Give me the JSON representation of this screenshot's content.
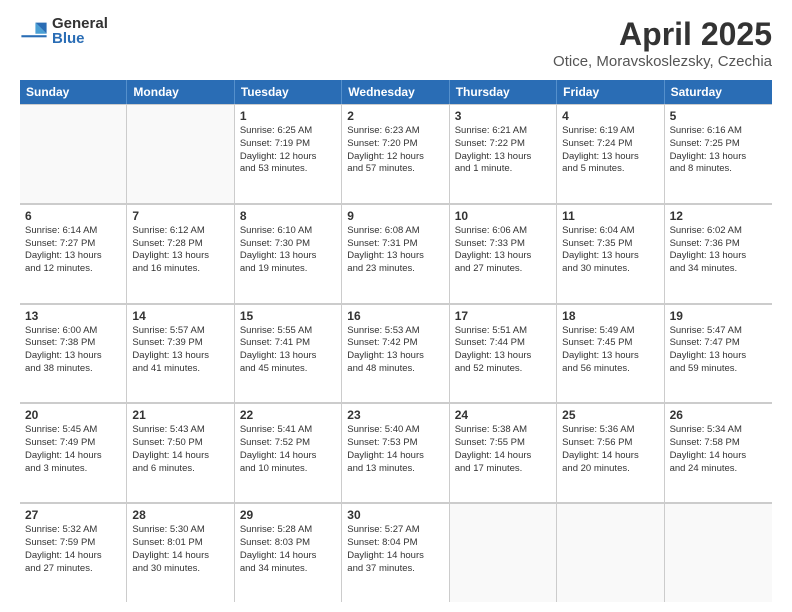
{
  "logo": {
    "general": "General",
    "blue": "Blue"
  },
  "title": "April 2025",
  "subtitle": "Otice, Moravskoslezsky, Czechia",
  "weekdays": [
    "Sunday",
    "Monday",
    "Tuesday",
    "Wednesday",
    "Thursday",
    "Friday",
    "Saturday"
  ],
  "weeks": [
    [
      {
        "day": "",
        "lines": []
      },
      {
        "day": "",
        "lines": []
      },
      {
        "day": "1",
        "lines": [
          "Sunrise: 6:25 AM",
          "Sunset: 7:19 PM",
          "Daylight: 12 hours",
          "and 53 minutes."
        ]
      },
      {
        "day": "2",
        "lines": [
          "Sunrise: 6:23 AM",
          "Sunset: 7:20 PM",
          "Daylight: 12 hours",
          "and 57 minutes."
        ]
      },
      {
        "day": "3",
        "lines": [
          "Sunrise: 6:21 AM",
          "Sunset: 7:22 PM",
          "Daylight: 13 hours",
          "and 1 minute."
        ]
      },
      {
        "day": "4",
        "lines": [
          "Sunrise: 6:19 AM",
          "Sunset: 7:24 PM",
          "Daylight: 13 hours",
          "and 5 minutes."
        ]
      },
      {
        "day": "5",
        "lines": [
          "Sunrise: 6:16 AM",
          "Sunset: 7:25 PM",
          "Daylight: 13 hours",
          "and 8 minutes."
        ]
      }
    ],
    [
      {
        "day": "6",
        "lines": [
          "Sunrise: 6:14 AM",
          "Sunset: 7:27 PM",
          "Daylight: 13 hours",
          "and 12 minutes."
        ]
      },
      {
        "day": "7",
        "lines": [
          "Sunrise: 6:12 AM",
          "Sunset: 7:28 PM",
          "Daylight: 13 hours",
          "and 16 minutes."
        ]
      },
      {
        "day": "8",
        "lines": [
          "Sunrise: 6:10 AM",
          "Sunset: 7:30 PM",
          "Daylight: 13 hours",
          "and 19 minutes."
        ]
      },
      {
        "day": "9",
        "lines": [
          "Sunrise: 6:08 AM",
          "Sunset: 7:31 PM",
          "Daylight: 13 hours",
          "and 23 minutes."
        ]
      },
      {
        "day": "10",
        "lines": [
          "Sunrise: 6:06 AM",
          "Sunset: 7:33 PM",
          "Daylight: 13 hours",
          "and 27 minutes."
        ]
      },
      {
        "day": "11",
        "lines": [
          "Sunrise: 6:04 AM",
          "Sunset: 7:35 PM",
          "Daylight: 13 hours",
          "and 30 minutes."
        ]
      },
      {
        "day": "12",
        "lines": [
          "Sunrise: 6:02 AM",
          "Sunset: 7:36 PM",
          "Daylight: 13 hours",
          "and 34 minutes."
        ]
      }
    ],
    [
      {
        "day": "13",
        "lines": [
          "Sunrise: 6:00 AM",
          "Sunset: 7:38 PM",
          "Daylight: 13 hours",
          "and 38 minutes."
        ]
      },
      {
        "day": "14",
        "lines": [
          "Sunrise: 5:57 AM",
          "Sunset: 7:39 PM",
          "Daylight: 13 hours",
          "and 41 minutes."
        ]
      },
      {
        "day": "15",
        "lines": [
          "Sunrise: 5:55 AM",
          "Sunset: 7:41 PM",
          "Daylight: 13 hours",
          "and 45 minutes."
        ]
      },
      {
        "day": "16",
        "lines": [
          "Sunrise: 5:53 AM",
          "Sunset: 7:42 PM",
          "Daylight: 13 hours",
          "and 48 minutes."
        ]
      },
      {
        "day": "17",
        "lines": [
          "Sunrise: 5:51 AM",
          "Sunset: 7:44 PM",
          "Daylight: 13 hours",
          "and 52 minutes."
        ]
      },
      {
        "day": "18",
        "lines": [
          "Sunrise: 5:49 AM",
          "Sunset: 7:45 PM",
          "Daylight: 13 hours",
          "and 56 minutes."
        ]
      },
      {
        "day": "19",
        "lines": [
          "Sunrise: 5:47 AM",
          "Sunset: 7:47 PM",
          "Daylight: 13 hours",
          "and 59 minutes."
        ]
      }
    ],
    [
      {
        "day": "20",
        "lines": [
          "Sunrise: 5:45 AM",
          "Sunset: 7:49 PM",
          "Daylight: 14 hours",
          "and 3 minutes."
        ]
      },
      {
        "day": "21",
        "lines": [
          "Sunrise: 5:43 AM",
          "Sunset: 7:50 PM",
          "Daylight: 14 hours",
          "and 6 minutes."
        ]
      },
      {
        "day": "22",
        "lines": [
          "Sunrise: 5:41 AM",
          "Sunset: 7:52 PM",
          "Daylight: 14 hours",
          "and 10 minutes."
        ]
      },
      {
        "day": "23",
        "lines": [
          "Sunrise: 5:40 AM",
          "Sunset: 7:53 PM",
          "Daylight: 14 hours",
          "and 13 minutes."
        ]
      },
      {
        "day": "24",
        "lines": [
          "Sunrise: 5:38 AM",
          "Sunset: 7:55 PM",
          "Daylight: 14 hours",
          "and 17 minutes."
        ]
      },
      {
        "day": "25",
        "lines": [
          "Sunrise: 5:36 AM",
          "Sunset: 7:56 PM",
          "Daylight: 14 hours",
          "and 20 minutes."
        ]
      },
      {
        "day": "26",
        "lines": [
          "Sunrise: 5:34 AM",
          "Sunset: 7:58 PM",
          "Daylight: 14 hours",
          "and 24 minutes."
        ]
      }
    ],
    [
      {
        "day": "27",
        "lines": [
          "Sunrise: 5:32 AM",
          "Sunset: 7:59 PM",
          "Daylight: 14 hours",
          "and 27 minutes."
        ]
      },
      {
        "day": "28",
        "lines": [
          "Sunrise: 5:30 AM",
          "Sunset: 8:01 PM",
          "Daylight: 14 hours",
          "and 30 minutes."
        ]
      },
      {
        "day": "29",
        "lines": [
          "Sunrise: 5:28 AM",
          "Sunset: 8:03 PM",
          "Daylight: 14 hours",
          "and 34 minutes."
        ]
      },
      {
        "day": "30",
        "lines": [
          "Sunrise: 5:27 AM",
          "Sunset: 8:04 PM",
          "Daylight: 14 hours",
          "and 37 minutes."
        ]
      },
      {
        "day": "",
        "lines": []
      },
      {
        "day": "",
        "lines": []
      },
      {
        "day": "",
        "lines": []
      }
    ]
  ]
}
